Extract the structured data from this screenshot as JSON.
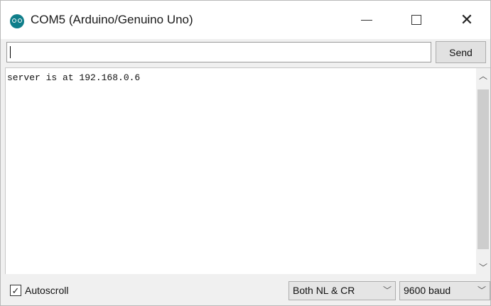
{
  "window": {
    "title": "COM5 (Arduino/Genuino Uno)",
    "controls": {
      "minimize": "—",
      "maximize": "□",
      "close": "✕"
    }
  },
  "input": {
    "value": "",
    "send_label": "Send"
  },
  "output": {
    "lines": [
      "server is at 192.168.0.6"
    ]
  },
  "footer": {
    "autoscroll_label": "Autoscroll",
    "autoscroll_checked": true,
    "line_ending": "Both NL & CR",
    "baud_rate": "9600 baud"
  },
  "icons": {
    "app": "arduino-icon",
    "up": "chevron-up-icon",
    "down": "chevron-down-icon",
    "checkbox": "checkmark-icon"
  },
  "colors": {
    "brand": "#0f7e8a"
  }
}
